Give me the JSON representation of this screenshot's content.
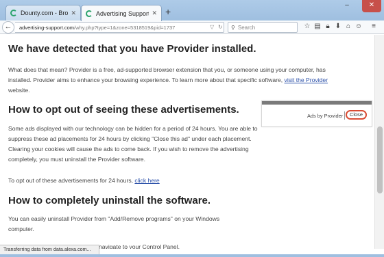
{
  "tabs": [
    {
      "title": "Dounty.com - Browser Sec...",
      "active": false
    },
    {
      "title": "Advertising Support",
      "active": true
    }
  ],
  "toolbar": {
    "url_host": "advertising-support.com",
    "url_path": "/why.php?type=1&zone=5318519&pid=1737",
    "search_placeholder": "Search"
  },
  "content": {
    "h1": "We have detected that you have Provider installed.",
    "p1_text": "What does that mean? Provider is a free, ad-supported browser extension that you, or someone using your computer, has installed. Provider aims to enhance your browsing experience. To learn more about that specific software, ",
    "p1_link": "visit the Provider",
    "p1_end": " website.",
    "h2": "How to opt out of seeing these advertisements.",
    "p2": "Some ads displayed with our technology can be hidden for a period of 24 hours. You are able to suppress these ad placements for 24 hours by clicking \"Close this ad\" under each placement. Clearing your cookies will cause the ads to come back. If you wish to remove the advertising completely, you must uninstall the Provider software.",
    "p3_text": "To opt out of these advertisements for 24 hours, ",
    "p3_link": "click here",
    "h3": "How to completely uninstall the software.",
    "p4": "You can easily uninstall Provider from \"Add/Remove programs\" on your Windows computer.",
    "p5": "navigate to your Control Panel."
  },
  "ad_popup": {
    "label": "Ads by Provider",
    "close": "Close",
    "close_highlight_color": "#d94c34"
  },
  "status_bar": "Transferring data from data.alexa.com...",
  "icons": [
    "back-icon",
    "search-icon",
    "star-icon",
    "reading-list-icon",
    "lock-icon",
    "download-icon",
    "home-icon",
    "chat-icon",
    "menu-icon"
  ]
}
